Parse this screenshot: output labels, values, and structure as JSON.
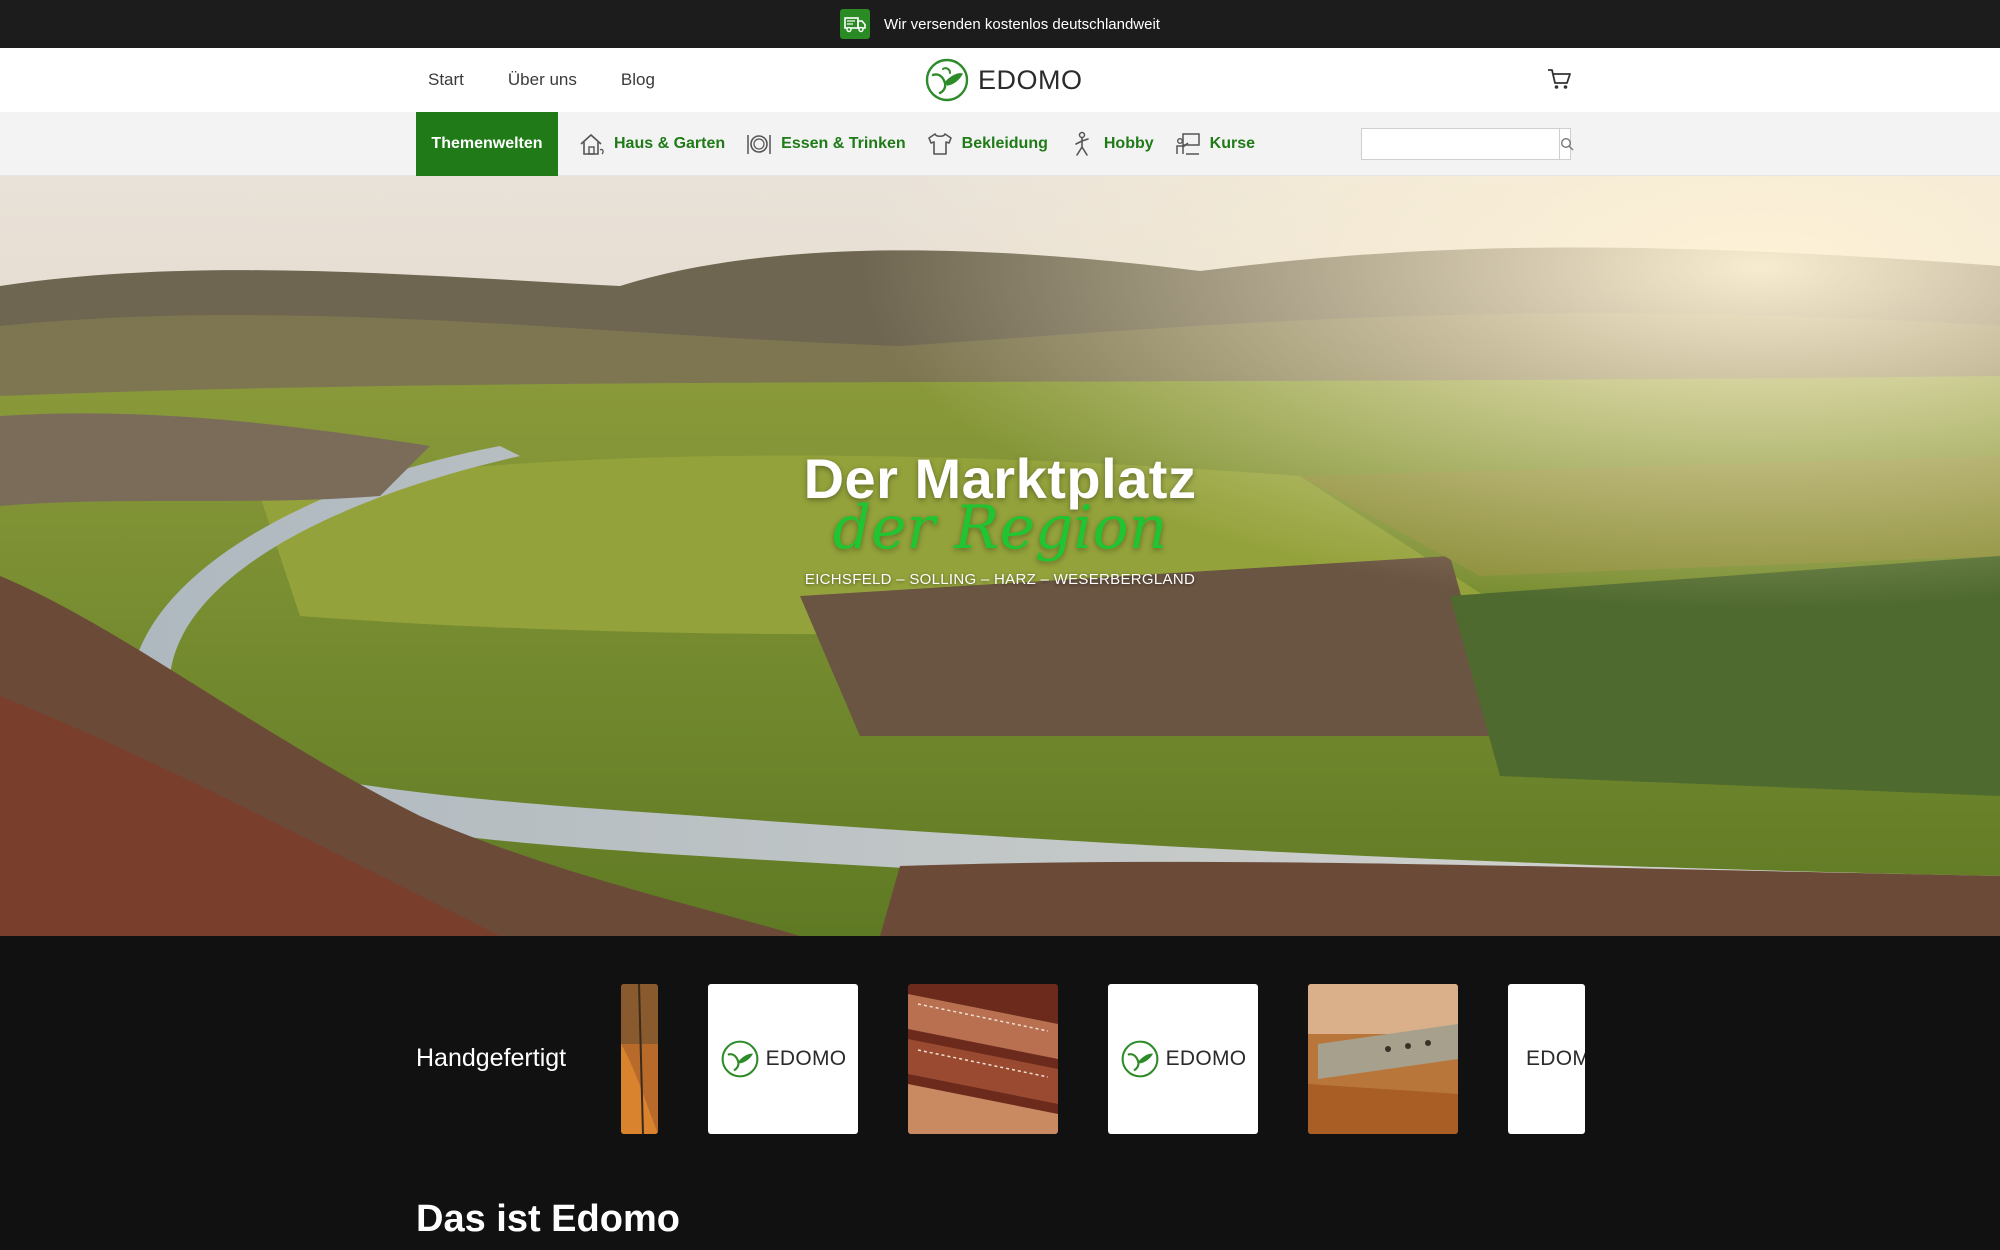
{
  "promo": {
    "text": "Wir versenden kostenlos deutschlandweit",
    "icon": "truck-icon"
  },
  "header": {
    "nav": [
      "Start",
      "Über uns",
      "Blog"
    ],
    "logo_text": "EDOMO",
    "cart_icon": "cart-icon"
  },
  "categories": {
    "theme_button": "Themenwelten",
    "items": [
      {
        "label": "Haus & Garten",
        "icon": "house-icon"
      },
      {
        "label": "Essen & Trinken",
        "icon": "plate-icon"
      },
      {
        "label": "Bekleidung",
        "icon": "shirt-icon"
      },
      {
        "label": "Hobby",
        "icon": "hobby-icon"
      },
      {
        "label": "Kurse",
        "icon": "classroom-icon"
      }
    ],
    "search_placeholder": "",
    "search_icon": "search-icon"
  },
  "hero": {
    "title": "Der Marktplatz",
    "script": "der Region",
    "subtitle": "EICHSFELD – SOLLING – HARZ – WESERBERGLAND"
  },
  "feature": {
    "label": "Handgefertigt",
    "slides": [
      {
        "type": "photo",
        "subject": "leather-edge"
      },
      {
        "type": "logo",
        "text": "EDOMO"
      },
      {
        "type": "photo",
        "subject": "leather-straps"
      },
      {
        "type": "logo",
        "text": "EDOMO"
      },
      {
        "type": "photo",
        "subject": "watch-strap"
      },
      {
        "type": "logo",
        "text": "EDOMO"
      }
    ]
  },
  "section": {
    "title": "Das ist Edomo"
  },
  "colors": {
    "brand_green": "#1f7a17",
    "script_green": "#21c431",
    "dark": "#111111",
    "promo_bg": "#1c1c1c"
  }
}
